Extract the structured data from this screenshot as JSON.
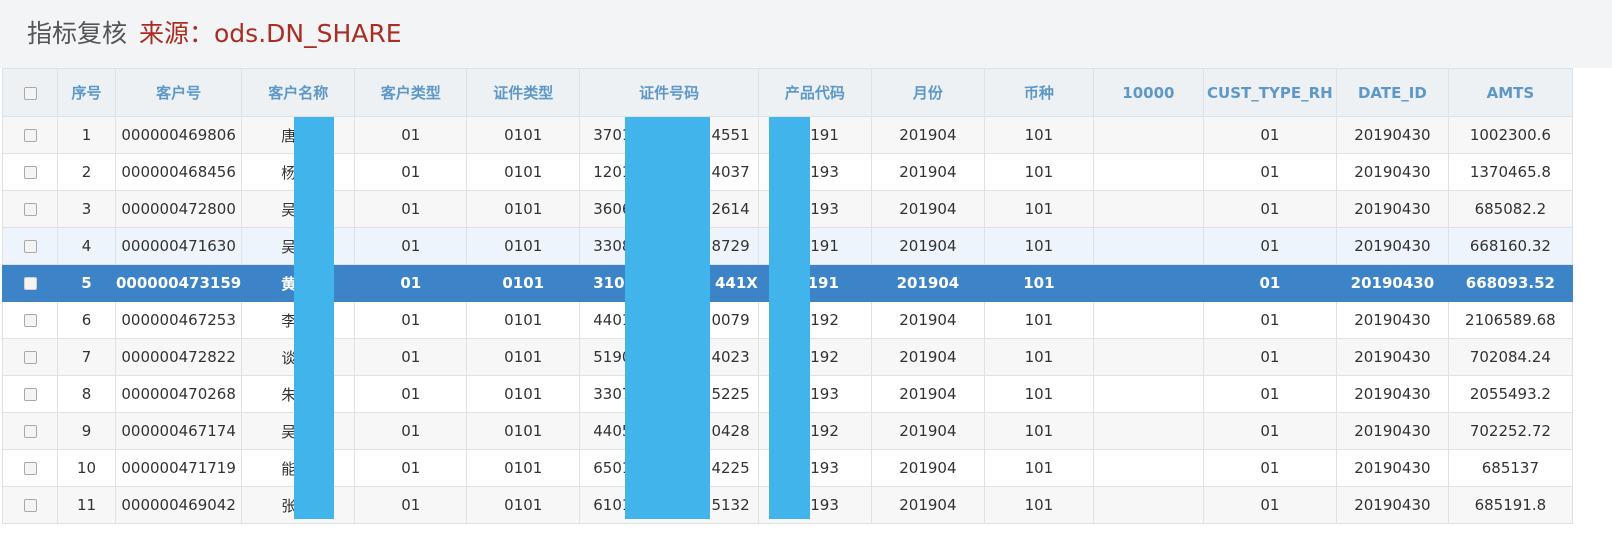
{
  "title": {
    "main": "指标复核",
    "source": "来源：ods.DN_SHARE"
  },
  "table": {
    "columns": [
      "",
      "序号",
      "客户号",
      "客户名称",
      "客户类型",
      "证件类型",
      "证件号码",
      "产品代码",
      "月份",
      "币种",
      "10000",
      "CUST_TYPE_RH",
      "DATE_ID",
      "AMTS"
    ],
    "selected_row": 5,
    "hover_row": 4,
    "rows": [
      {
        "seq": "1",
        "cust_no": "000000469806",
        "cust_name": "唐",
        "cust_type": "01",
        "id_type": "0101",
        "id_prefix": "3701",
        "id_suffix": "4551",
        "product": "191",
        "month": "201904",
        "currency": "101",
        "c10000": "",
        "cust_type_rh": "01",
        "date_id": "20190430",
        "amts": "1002300.6"
      },
      {
        "seq": "2",
        "cust_no": "000000468456",
        "cust_name": "杨",
        "cust_type": "01",
        "id_type": "0101",
        "id_prefix": "1201",
        "id_suffix": "4037",
        "product": "193",
        "month": "201904",
        "currency": "101",
        "c10000": "",
        "cust_type_rh": "01",
        "date_id": "20190430",
        "amts": "1370465.8"
      },
      {
        "seq": "3",
        "cust_no": "000000472800",
        "cust_name": "吴",
        "cust_type": "01",
        "id_type": "0101",
        "id_prefix": "3606",
        "id_suffix": "2614",
        "product": "193",
        "month": "201904",
        "currency": "101",
        "c10000": "",
        "cust_type_rh": "01",
        "date_id": "20190430",
        "amts": "685082.2"
      },
      {
        "seq": "4",
        "cust_no": "000000471630",
        "cust_name": "吴",
        "cust_type": "01",
        "id_type": "0101",
        "id_prefix": "3308",
        "id_suffix": "8729",
        "product": "191",
        "month": "201904",
        "currency": "101",
        "c10000": "",
        "cust_type_rh": "01",
        "date_id": "20190430",
        "amts": "668160.32"
      },
      {
        "seq": "5",
        "cust_no": "000000473159",
        "cust_name": "黄",
        "cust_type": "01",
        "id_type": "0101",
        "id_prefix": "3101",
        "id_suffix": "441X",
        "product": "191",
        "month": "201904",
        "currency": "101",
        "c10000": "",
        "cust_type_rh": "01",
        "date_id": "20190430",
        "amts": "668093.52"
      },
      {
        "seq": "6",
        "cust_no": "000000467253",
        "cust_name": "李",
        "cust_type": "01",
        "id_type": "0101",
        "id_prefix": "4401",
        "id_suffix": "0079",
        "product": "192",
        "month": "201904",
        "currency": "101",
        "c10000": "",
        "cust_type_rh": "01",
        "date_id": "20190430",
        "amts": "2106589.68"
      },
      {
        "seq": "7",
        "cust_no": "000000472822",
        "cust_name": "谈",
        "cust_type": "01",
        "id_type": "0101",
        "id_prefix": "5190",
        "id_suffix": "4023",
        "product": "192",
        "month": "201904",
        "currency": "101",
        "c10000": "",
        "cust_type_rh": "01",
        "date_id": "20190430",
        "amts": "702084.24"
      },
      {
        "seq": "8",
        "cust_no": "000000470268",
        "cust_name": "朱",
        "cust_type": "01",
        "id_type": "0101",
        "id_prefix": "3307",
        "id_suffix": "5225",
        "product": "193",
        "month": "201904",
        "currency": "101",
        "c10000": "",
        "cust_type_rh": "01",
        "date_id": "20190430",
        "amts": "2055493.2"
      },
      {
        "seq": "9",
        "cust_no": "000000467174",
        "cust_name": "吴",
        "cust_type": "01",
        "id_type": "0101",
        "id_prefix": "4405",
        "id_suffix": "0428",
        "product": "192",
        "month": "201904",
        "currency": "101",
        "c10000": "",
        "cust_type_rh": "01",
        "date_id": "20190430",
        "amts": "702252.72"
      },
      {
        "seq": "10",
        "cust_no": "000000471719",
        "cust_name": "能",
        "cust_type": "01",
        "id_type": "0101",
        "id_prefix": "6501",
        "id_suffix": "4225",
        "product": "193",
        "month": "201904",
        "currency": "101",
        "c10000": "",
        "cust_type_rh": "01",
        "date_id": "20190430",
        "amts": "685137"
      },
      {
        "seq": "11",
        "cust_no": "000000469042",
        "cust_name": "张",
        "cust_type": "01",
        "id_type": "0101",
        "id_prefix": "6101",
        "id_suffix": "5132",
        "product": "193",
        "month": "201904",
        "currency": "101",
        "c10000": "",
        "cust_type_rh": "01",
        "date_id": "20190430",
        "amts": "685191.8"
      }
    ]
  },
  "colors": {
    "header_text": "#5d98c8",
    "title_source": "#a92d23",
    "selected_row": "#3c84c7",
    "redaction": "#41b5eb"
  }
}
